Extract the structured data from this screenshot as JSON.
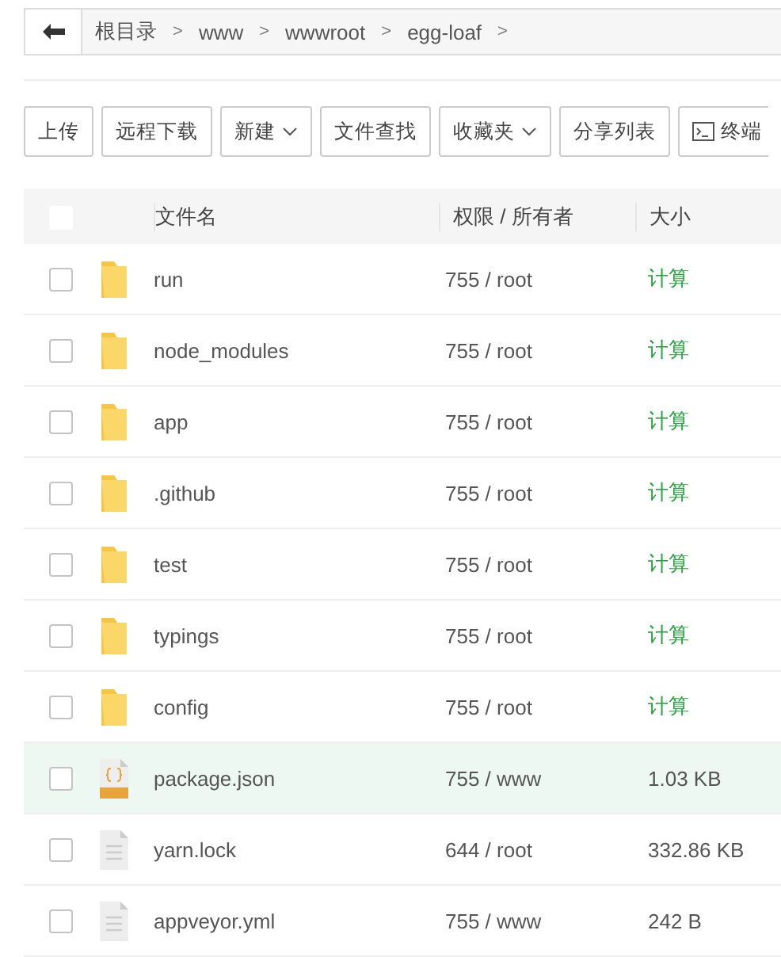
{
  "breadcrumb": {
    "items": [
      "根目录",
      "www",
      "wwwroot",
      "egg-loaf"
    ],
    "separator": ">"
  },
  "toolbar": [
    {
      "label": "上传",
      "dropdown": false,
      "icon": false
    },
    {
      "label": "远程下载",
      "dropdown": false,
      "icon": false
    },
    {
      "label": "新建",
      "dropdown": true,
      "icon": false
    },
    {
      "label": "文件查找",
      "dropdown": false,
      "icon": false
    },
    {
      "label": "收藏夹",
      "dropdown": true,
      "icon": false
    },
    {
      "label": "分享列表",
      "dropdown": false,
      "icon": false
    },
    {
      "label": "终端",
      "dropdown": false,
      "icon": true
    }
  ],
  "table": {
    "select_all_checked": false,
    "columns": [
      "文件名",
      "权限 / 所有者",
      "大小"
    ],
    "rows": [
      {
        "kind": "folder",
        "name": "run",
        "permissions": "755 / root",
        "size": "计算",
        "size_link": true,
        "checked": false,
        "highlighted": false
      },
      {
        "kind": "folder",
        "name": "node_modules",
        "permissions": "755 / root",
        "size": "计算",
        "size_link": true,
        "checked": false,
        "highlighted": false
      },
      {
        "kind": "folder",
        "name": "app",
        "permissions": "755 / root",
        "size": "计算",
        "size_link": true,
        "checked": false,
        "highlighted": false
      },
      {
        "kind": "folder",
        "name": ".github",
        "permissions": "755 / root",
        "size": "计算",
        "size_link": true,
        "checked": false,
        "highlighted": false
      },
      {
        "kind": "folder",
        "name": "test",
        "permissions": "755 / root",
        "size": "计算",
        "size_link": true,
        "checked": false,
        "highlighted": false
      },
      {
        "kind": "folder",
        "name": "typings",
        "permissions": "755 / root",
        "size": "计算",
        "size_link": true,
        "checked": false,
        "highlighted": false
      },
      {
        "kind": "folder",
        "name": "config",
        "permissions": "755 / root",
        "size": "计算",
        "size_link": true,
        "checked": false,
        "highlighted": false
      },
      {
        "kind": "json",
        "name": "package.json",
        "permissions": "755 / www",
        "size": "1.03 KB",
        "size_link": false,
        "checked": false,
        "highlighted": true
      },
      {
        "kind": "file",
        "name": "yarn.lock",
        "permissions": "644 / root",
        "size": "332.86 KB",
        "size_link": false,
        "checked": false,
        "highlighted": false
      },
      {
        "kind": "file",
        "name": "appveyor.yml",
        "permissions": "755 / www",
        "size": "242 B",
        "size_link": false,
        "checked": false,
        "highlighted": false
      }
    ]
  }
}
